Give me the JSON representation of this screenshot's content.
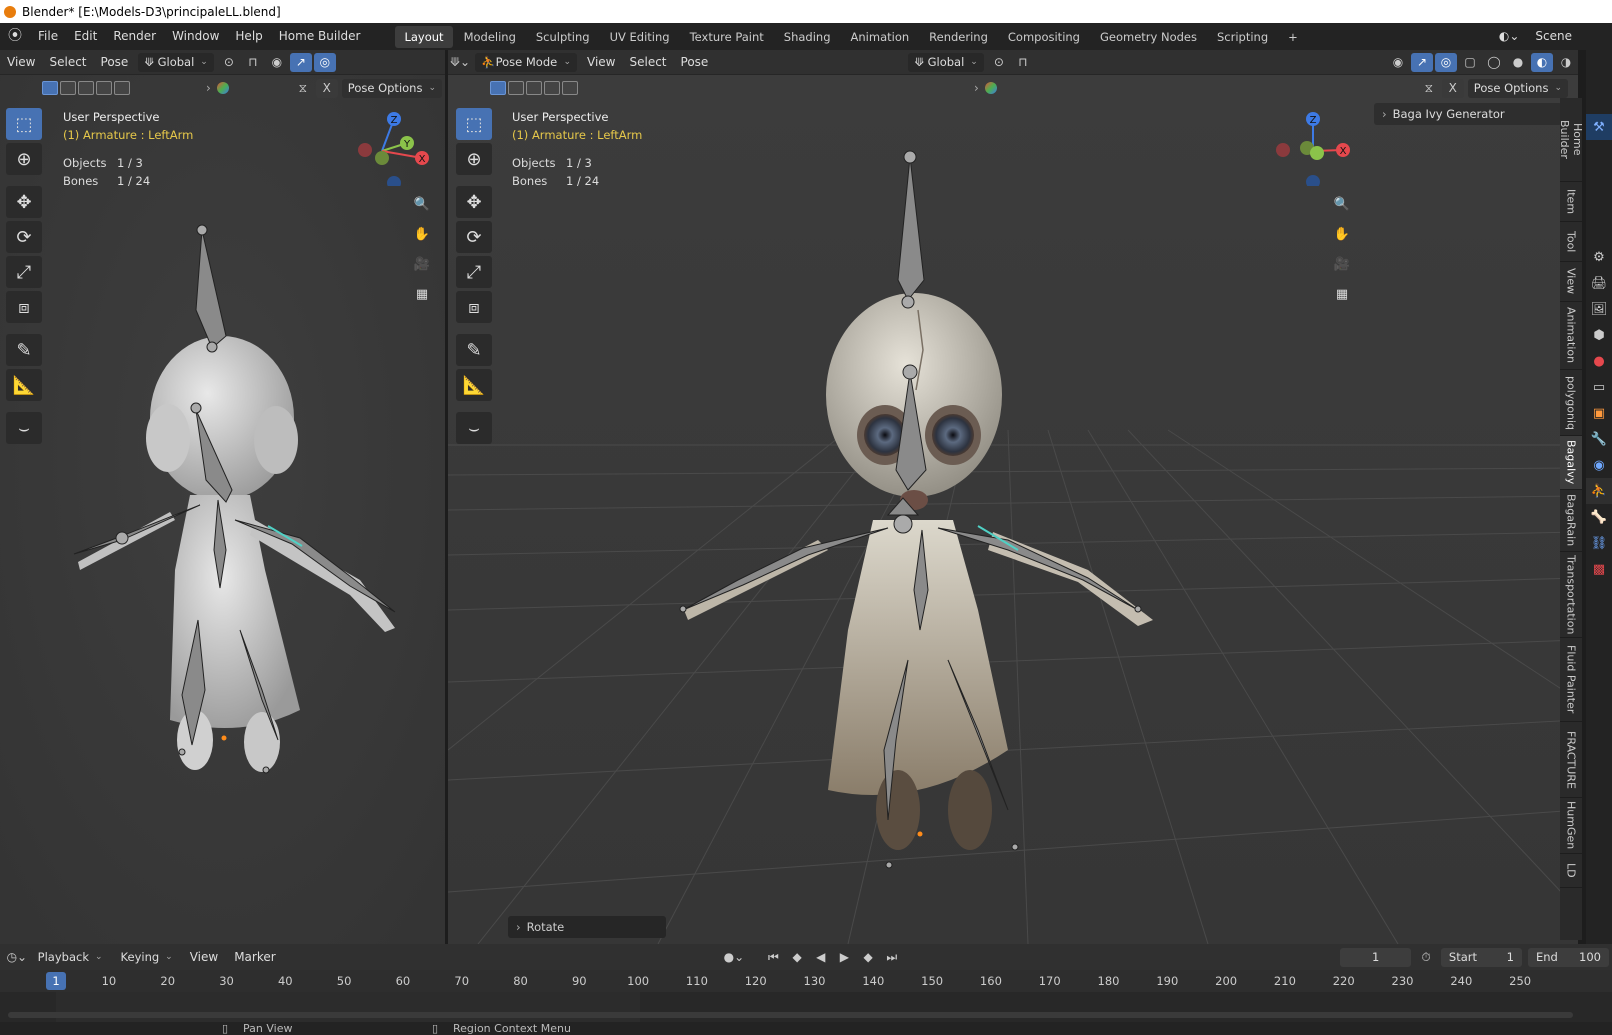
{
  "window": {
    "title": "Blender* [E:\\Models-D3\\principaleLL.blend]"
  },
  "topbar": {
    "menus": [
      "File",
      "Edit",
      "Render",
      "Window",
      "Help",
      "Home Builder"
    ],
    "tabs": [
      "Layout",
      "Modeling",
      "Sculpting",
      "UV Editing",
      "Texture Paint",
      "Shading",
      "Animation",
      "Rendering",
      "Compositing",
      "Geometry Nodes",
      "Scripting"
    ],
    "active_tab": "Layout",
    "add_tab": "+",
    "scene": "Scene"
  },
  "left_viewport": {
    "menus": [
      "View",
      "Select",
      "Pose"
    ],
    "orientation": "Global",
    "pose_options": "Pose Options",
    "x_label": "X",
    "perspective": "User Perspective",
    "active": "(1) Armature : LeftArm",
    "objects_label": "Objects",
    "objects_value": "1 / 3",
    "bones_label": "Bones",
    "bones_value": "1 / 24"
  },
  "right_viewport": {
    "mode": "Pose Mode",
    "menus": [
      "View",
      "Select",
      "Pose"
    ],
    "orientation": "Global",
    "pose_options": "Pose Options",
    "x_label": "X",
    "perspective": "User Perspective",
    "active": "(1) Armature : LeftArm",
    "objects_label": "Objects",
    "objects_value": "1 / 3",
    "bones_label": "Bones",
    "bones_value": "1 / 24",
    "panel": "Baga Ivy Generator",
    "last_operator": "Rotate"
  },
  "gizmo": {
    "z": "Z",
    "y": "Y",
    "x": "X"
  },
  "side_tabs": [
    "Home Builder",
    "Item",
    "Tool",
    "View",
    "Animation",
    "polygoniq",
    "BagaIvy",
    "BagaRain",
    "Transportation",
    "Fluid Painter",
    "FRACTURE",
    "HumGen",
    "LD"
  ],
  "active_side_tab": "BagaIvy",
  "timeline": {
    "menus": [
      "Playback",
      "Keying",
      "View",
      "Marker"
    ],
    "current_frame": "1",
    "start_label": "Start",
    "start": "1",
    "end_label": "End",
    "end": "100",
    "ticks": [
      "1",
      "10",
      "20",
      "30",
      "40",
      "50",
      "60",
      "70",
      "80",
      "90",
      "100",
      "110",
      "120",
      "130",
      "140",
      "150",
      "160",
      "170",
      "180",
      "190",
      "200",
      "210",
      "220",
      "230",
      "240",
      "250"
    ]
  },
  "statusbar": {
    "pan": "Pan View",
    "context": "Region Context Menu"
  },
  "colors": {
    "accent": "#4772b3",
    "active_text": "#e6c84a",
    "axis_x": "#e5484d",
    "axis_y": "#8bc34a",
    "axis_z": "#3d7ae5"
  }
}
